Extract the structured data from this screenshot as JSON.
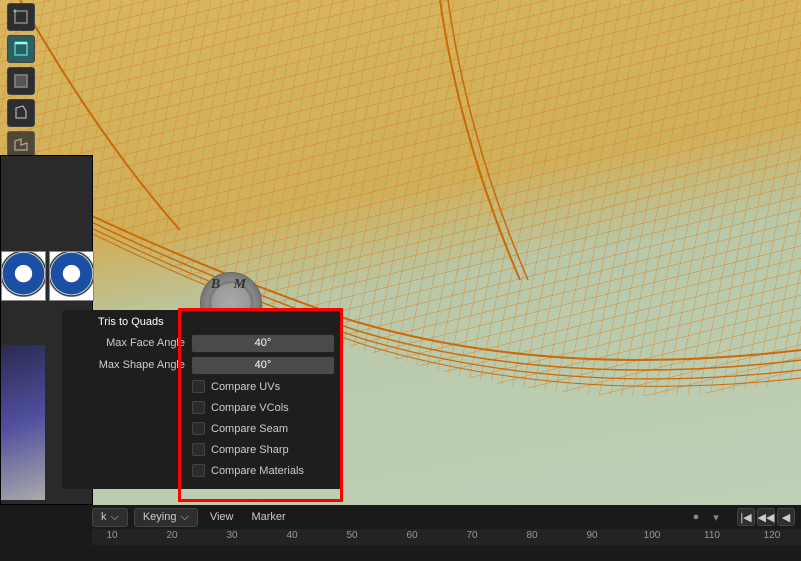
{
  "panel": {
    "title": "Tris to Quads",
    "max_face_angle_label": "Max Face Angle",
    "max_face_angle_value": "40°",
    "max_shape_angle_label": "Max Shape Angle",
    "max_shape_angle_value": "40°",
    "checks": {
      "compare_uvs": "Compare UVs",
      "compare_vcols": "Compare VCols",
      "compare_seam": "Compare Seam",
      "compare_sharp": "Compare Sharp",
      "compare_materials": "Compare Materials"
    }
  },
  "timeline": {
    "dropdown_k": "k",
    "keying": "Keying",
    "view": "View",
    "marker": "Marker",
    "frames": [
      "10",
      "20",
      "30",
      "40",
      "50",
      "60",
      "70",
      "80",
      "90",
      "100",
      "110",
      "120"
    ]
  },
  "badge_text": "B M",
  "icons": {
    "caret": "⌵",
    "play_start": "|◀",
    "prev_key": "◀◀",
    "prev": "◀",
    "circle": "●",
    "tri": "▾"
  }
}
